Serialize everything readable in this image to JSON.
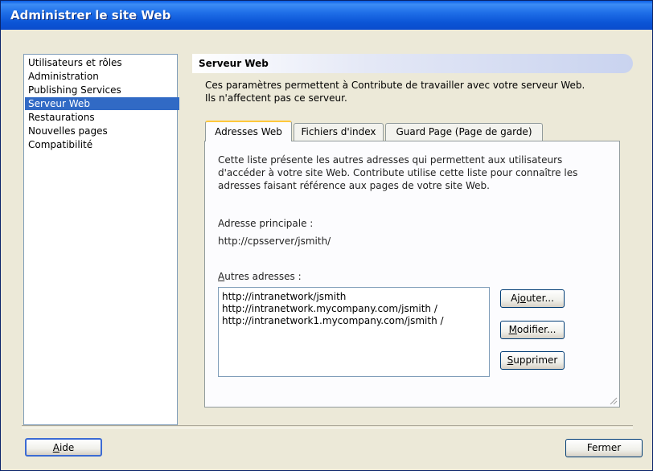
{
  "window": {
    "title": "Administrer le site Web"
  },
  "sidebar": {
    "items": [
      {
        "label": "Utilisateurs et rôles"
      },
      {
        "label": "Administration"
      },
      {
        "label": "Publishing Services"
      },
      {
        "label": "Serveur Web",
        "selected": true
      },
      {
        "label": "Restaurations"
      },
      {
        "label": "Nouvelles pages"
      },
      {
        "label": "Compatibilité"
      }
    ]
  },
  "section": {
    "title": "Serveur Web",
    "description_line1": "Ces paramètres permettent à Contribute de travailler avec votre serveur Web.",
    "description_line2": "Ils n'affectent pas ce serveur."
  },
  "tabs": [
    {
      "label": "Adresses Web",
      "active": true
    },
    {
      "label": "Fichiers d'index"
    },
    {
      "label": "Guard Page (Page de garde)"
    }
  ],
  "panel": {
    "intro_line1": "Cette liste présente les autres adresses qui permettent aux utilisateurs",
    "intro_line2": "d'accéder à votre site Web. Contribute utilise cette liste pour connaître les",
    "intro_line3": "adresses faisant référence aux pages de votre site Web.",
    "primary_label": "Adresse principale :",
    "primary_value": "http://cpsserver/jsmith/",
    "other_label_accel": "A",
    "other_label_rest": "utres adresses :",
    "addresses": [
      "http://intranetwork/jsmith",
      "http://intranetwork.mycompany.com/jsmith /",
      "http://intranetwork1.mycompany.com/jsmith /"
    ],
    "add_button_pre": "Aj",
    "add_button_accel": "o",
    "add_button_post": "uter...",
    "modify_button_accel": "M",
    "modify_button_post": "odifier...",
    "delete_button_accel": "S",
    "delete_button_post": "upprimer"
  },
  "footer": {
    "help_accel": "A",
    "help_post": "ide",
    "close_label": "Fermer"
  },
  "colors": {
    "titlebar": "#0b55d6",
    "selection": "#316ac5",
    "window_bg": "#ece9d8",
    "active_tab_accent": "#ffc83c"
  }
}
